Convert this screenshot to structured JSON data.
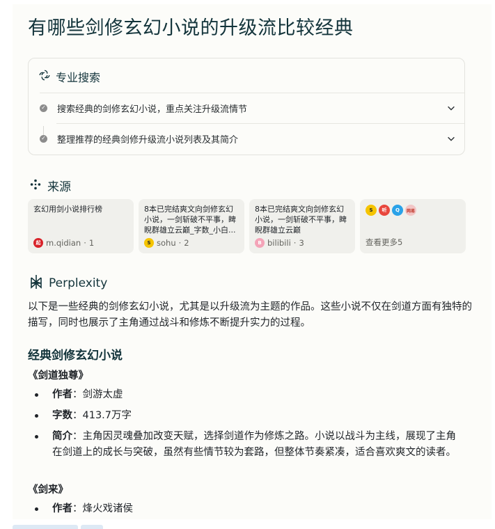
{
  "question": "有哪些剑修玄幻小说的升级流比较经典",
  "pro_search": {
    "title": "专业搜索",
    "steps": [
      {
        "label": "搜索经典的剑修玄幻小说，重点关注升级流情节"
      },
      {
        "label": "整理推荐的经典剑修升级流小说列表及其简介"
      }
    ]
  },
  "sources": {
    "title": "来源",
    "cards": [
      {
        "text": "玄幻用剑小说排行榜",
        "site": "m.qidian",
        "index": "1",
        "favicon_color": "#d8232a",
        "favicon_text": "起点"
      },
      {
        "text": "8本已完结爽文向剑修玄幻小说，一剑斩破不平事，睥睨群雄立云巅_字数_小白...",
        "site": "sohu",
        "index": "2",
        "favicon_color": "#f5c400",
        "favicon_text": "S"
      },
      {
        "text": "8本已完结爽文向剑修玄幻小说，一剑斩破不平事，睥睨群雄立云巅",
        "site": "bilibili",
        "index": "3",
        "favicon_color": "#f4a4b8",
        "favicon_text": "B"
      }
    ],
    "more": {
      "label": "查看更多5",
      "favicons": [
        {
          "color": "#f5c400",
          "text": "S"
        },
        {
          "color": "#e8473d",
          "text": "听"
        },
        {
          "color": "#2aa2e8",
          "text": "Q"
        },
        {
          "color": "#f2c6c6",
          "text": "网易"
        }
      ]
    }
  },
  "answer": {
    "brand": "Perplexity",
    "intro": "以下是一些经典的剑修玄幻小说，尤其是以升级流为主题的作品。这些小说不仅在剑道方面有独特的描写，同时也展示了主角通过战斗和修炼不断提升实力的过程。",
    "section_title": "经典剑修玄幻小说",
    "books": [
      {
        "title": "《剑道独尊》",
        "items": [
          {
            "key": "作者",
            "sep": "：",
            "value": "剑游太虚"
          },
          {
            "key": "字数",
            "sep": "：",
            "value": "413.7万字"
          },
          {
            "key": "简介",
            "sep": "：",
            "value": "主角因灵魂叠加改变天赋，选择剑道作为修炼之路。小说以战斗为主线，展现了主角在剑道上的成长与突破，虽然有些情节较为套路，但整体节奏紧凑，适合喜欢爽文的读者。"
          }
        ]
      },
      {
        "title": "《剑来》",
        "items": [
          {
            "key": "作者",
            "sep": "：",
            "value": "烽火戏诸侯"
          }
        ]
      }
    ]
  }
}
